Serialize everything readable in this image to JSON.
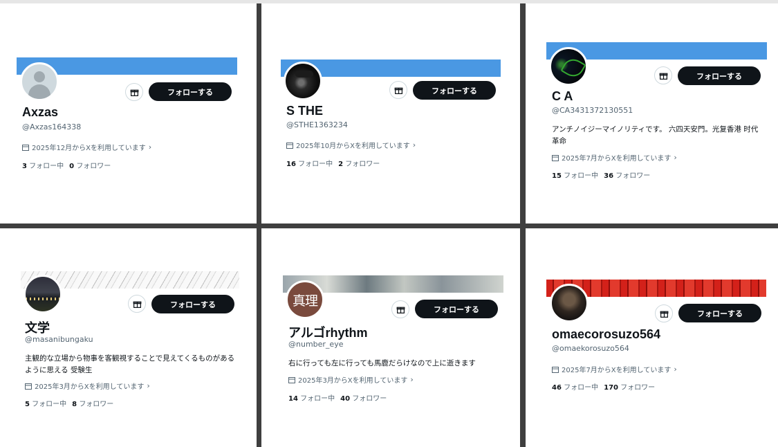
{
  "profiles": [
    {
      "name": "Axzas",
      "handle": "@Axzas164338",
      "bio": "",
      "joined": "2025年12月からXを利用しています",
      "following": "3",
      "following_label": "フォロー中",
      "followers": "0",
      "followers_label": "フォロワー",
      "follow_label": "フォローする",
      "avatar_icon": "default-avatar-icon"
    },
    {
      "name": "S THE",
      "handle": "@STHE1363234",
      "bio": "",
      "joined": "2025年10月からXを利用しています",
      "following": "16",
      "following_label": "フォロー中",
      "followers": "2",
      "followers_label": "フォロワー",
      "follow_label": "フォローする",
      "avatar_icon": "profile-photo"
    },
    {
      "name": "C A",
      "handle": "@CA3431372130551",
      "bio": "アンチノイジーマイノリティです。 六四天安門。光复香港 时代革命",
      "joined": "2025年7月からXを利用しています",
      "following": "15",
      "following_label": "フォロー中",
      "followers": "36",
      "followers_label": "フォロワー",
      "follow_label": "フォローする",
      "avatar_icon": "profile-photo"
    },
    {
      "name": "文学",
      "handle": "@masanibungaku",
      "bio": "主観的な立場から物事を客観視することで見えてくるものがあるように思える 受験生",
      "joined": "2025年3月からXを利用しています",
      "following": "5",
      "following_label": "フォロー中",
      "followers": "8",
      "followers_label": "フォロワー",
      "follow_label": "フォローする",
      "avatar_icon": "profile-photo"
    },
    {
      "name": "アルゴrhythm",
      "handle": "@number_eye",
      "bio": "右に行っても左に行っても馬鹿だらけなので上に逝きます",
      "joined": "2025年3月からXを利用しています",
      "following": "14",
      "following_label": "フォロー中",
      "followers": "40",
      "followers_label": "フォロワー",
      "follow_label": "フォローする",
      "avatar_icon": "profile-photo",
      "avatar_text": "真理"
    },
    {
      "name": "omaecorosuzo564",
      "handle": "@omaekorosuzo564",
      "bio": "",
      "joined": "2025年7月からXを利用しています",
      "following": "46",
      "following_label": "フォロー中",
      "followers": "170",
      "followers_label": "フォロワー",
      "follow_label": "フォローする",
      "avatar_icon": "profile-photo"
    }
  ],
  "icons": {
    "gift": "gift-icon",
    "calendar": "calendar-icon",
    "chevron": "chevron-right-icon"
  },
  "colors": {
    "banner_blue": "#4a98e3",
    "button": "#0f1419",
    "secondary_text": "#536471",
    "divider": "#3f3f3f"
  }
}
